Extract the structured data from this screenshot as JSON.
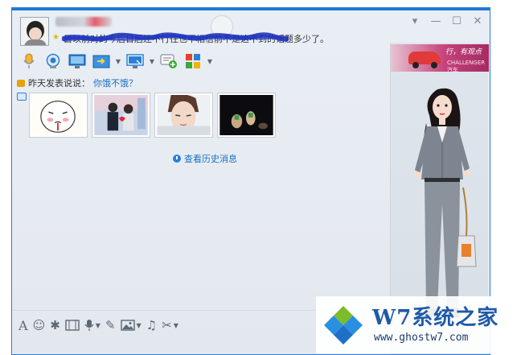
{
  "contact": {
    "signature": "目以前对的今后日后还不行往也不相信前不是这不到的话题多少了。"
  },
  "window_controls": {
    "dropdown": "▾",
    "minimize": "—",
    "maximize": "☐",
    "close": "✕"
  },
  "toolbar": {
    "items": [
      {
        "name": "voice-call-button",
        "icon": "microphone-icon"
      },
      {
        "name": "video-call-button",
        "icon": "webcam-icon"
      },
      {
        "name": "remote-desktop-button",
        "icon": "monitor-icon"
      },
      {
        "name": "send-file-button",
        "icon": "folder-arrow-icon"
      },
      {
        "name": "screen-share-button",
        "icon": "screen-icon"
      },
      {
        "name": "create-discussion-button",
        "icon": "chat-add-icon"
      },
      {
        "name": "apps-button",
        "icon": "apps-grid-icon"
      }
    ]
  },
  "notice": {
    "label": "昨天发表说说：",
    "link": "你饿不饿？"
  },
  "photos": [
    {
      "name": "photo-cartoon"
    },
    {
      "name": "photo-couple"
    },
    {
      "name": "photo-portrait"
    },
    {
      "name": "photo-dark"
    }
  ],
  "history": {
    "label": "查看历史消息"
  },
  "input_toolbar": {
    "font": "A",
    "emoji": "☺",
    "shake": "✱",
    "gif": "▮",
    "voice": "🎤",
    "edit": "✎",
    "image": "🖼",
    "music": "♫",
    "scissors": "✂"
  },
  "ad": {
    "line1": "行，有观点",
    "line2": "CHALLENGER 汽车"
  },
  "watermark": {
    "title": "W7系统之家",
    "url": "www.ghostw7.com"
  },
  "colors": {
    "accent": "#1e7ad8",
    "link": "#1a6fc2",
    "watermark_blue": "#1f5aa8",
    "watermark_green": "#7dbb2a"
  }
}
